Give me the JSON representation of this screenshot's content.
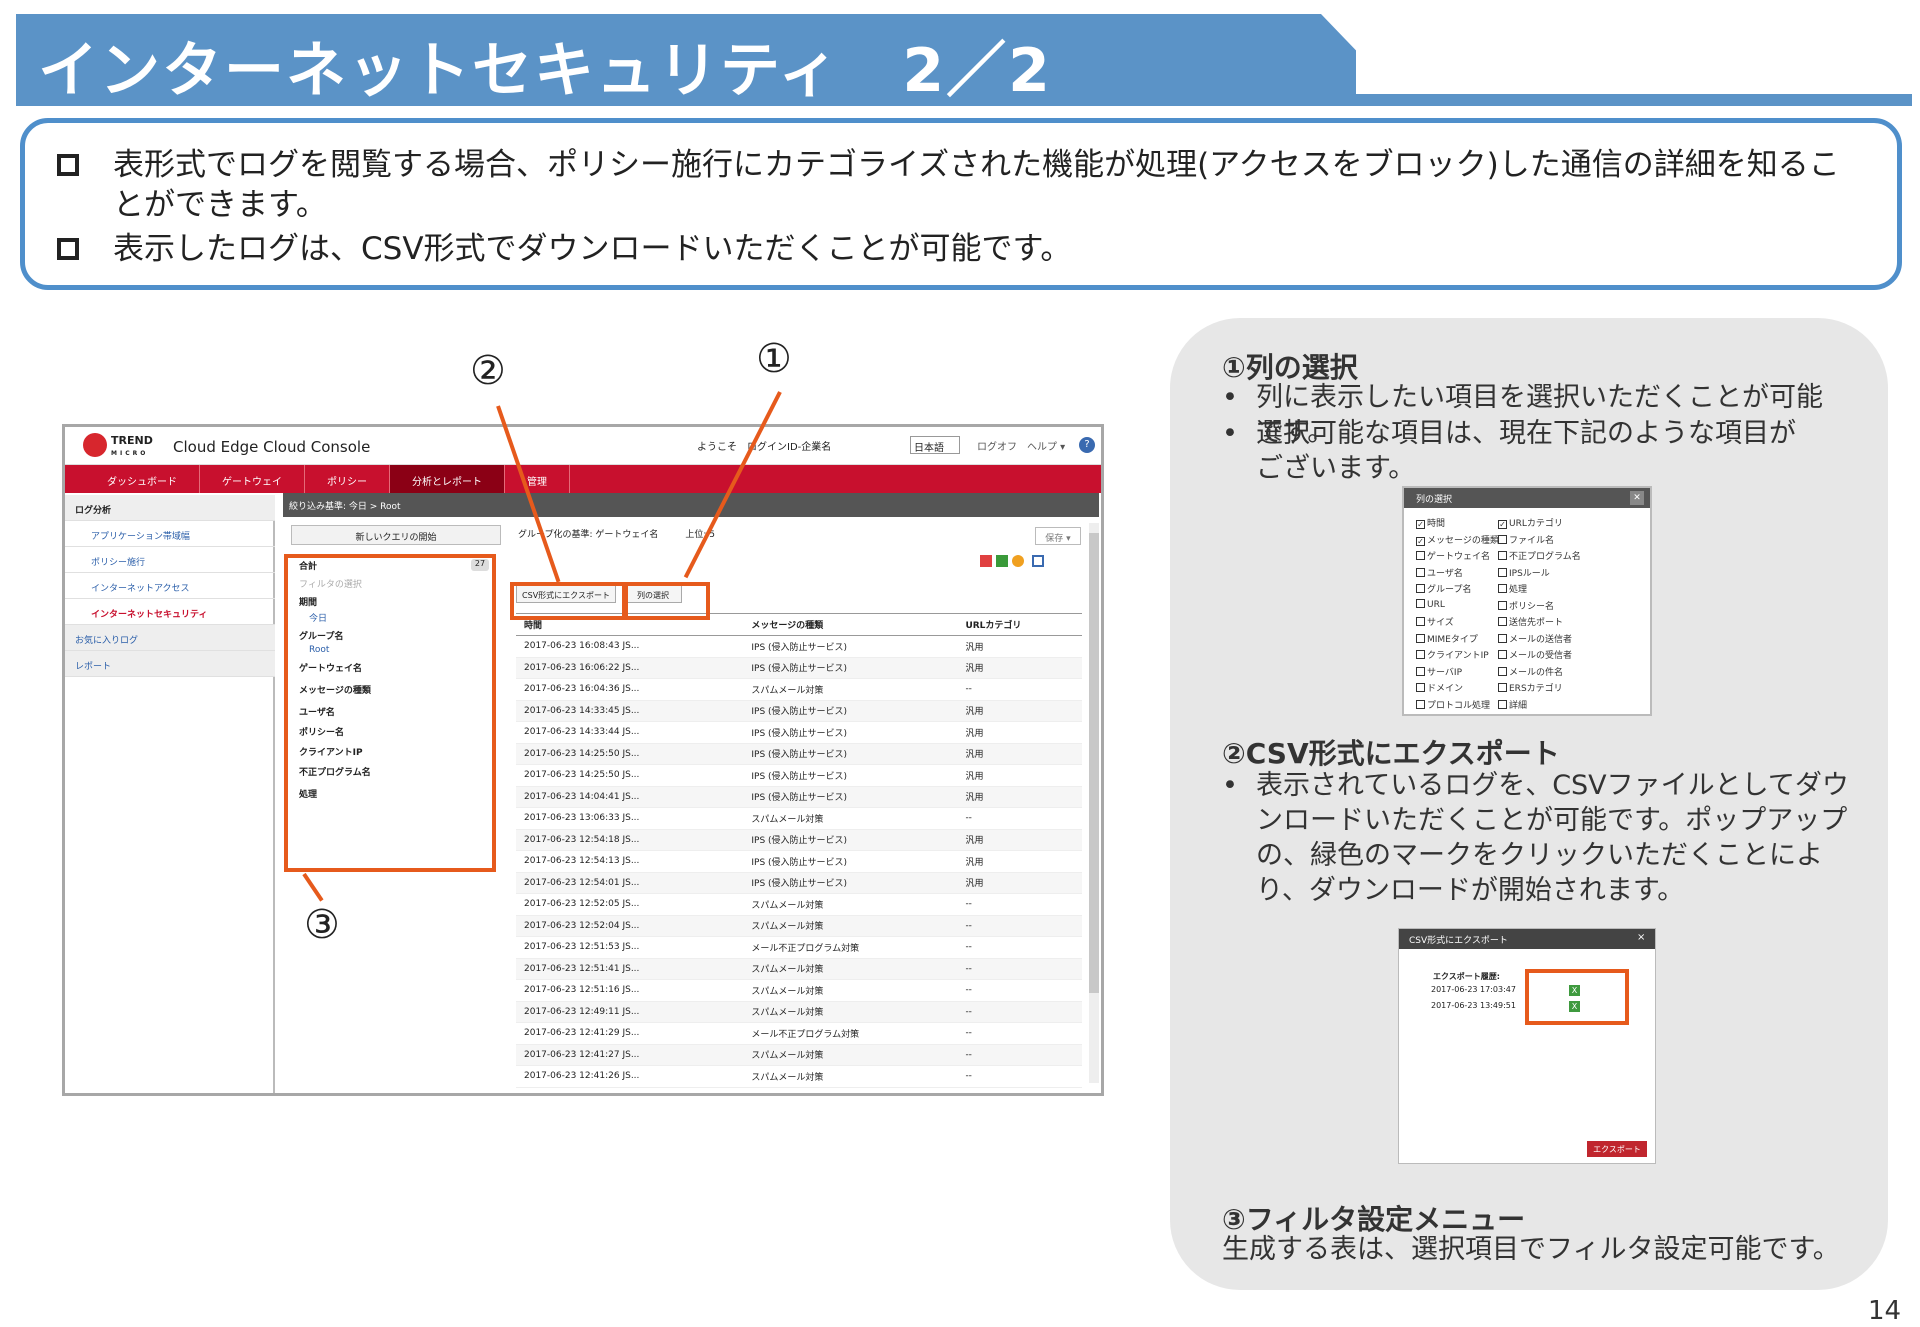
{
  "title": "インターネットセキュリティ　2／2",
  "bullets": [
    "表形式でログを閲覧する場合、ポリシー施行にカテゴライズされた機能が処理(アクセスをブロック)した通信の詳細を知ることができます。",
    "表示したログは、CSV形式でダウンロードいただくことが可能です。"
  ],
  "console": {
    "logo_text_1": "TREND",
    "logo_text_2": "MICRO",
    "app_title": "Cloud Edge Cloud Console",
    "welcome": "ようこそ　ログインID-企業名",
    "language": "日本語",
    "logout": "ログオフ",
    "help": "ヘルプ ▾",
    "help_icon": "?",
    "nav_tabs": [
      "ダッシュボード",
      "ゲートウェイ",
      "ポリシー",
      "分析とレポート",
      "管理"
    ],
    "left_menu": [
      "ログ分析",
      "アプリケーション帯域幅",
      "ポリシー施行",
      "インターネットアクセス",
      "インターネットセキュリティ",
      "お気に入りログ",
      "レポート"
    ],
    "breadcrumb": "絞り込み基準:  今日 > Root",
    "new_query": "新しいクエリの開始",
    "group_by": "グループ化の基準:  ゲートウェイ名",
    "top": "上位:  5",
    "save": "保存 ▾",
    "filter_total": "合計",
    "filter_total_count": "27",
    "filter_placeholder": "フィルタの選択",
    "filter_items": [
      "期間",
      "今日",
      "グループ名",
      "Root",
      "ゲートウェイ名",
      "メッセージの種類",
      "ユーザ名",
      "ポリシー名",
      "クライアントIP",
      "不正プログラム名",
      "処理"
    ],
    "btn_csv": "CSV形式にエクスポート",
    "btn_cols": "列の選択",
    "table_headers": [
      "時間",
      "メッセージの種類",
      "URLカテゴリ"
    ],
    "table_rows": [
      [
        "2017-06-23 16:08:43 JS...",
        "IPS (侵入防止サービス)",
        "汎用"
      ],
      [
        "2017-06-23 16:06:22 JS...",
        "IPS (侵入防止サービス)",
        "汎用"
      ],
      [
        "2017-06-23 16:04:36 JS...",
        "スパムメール対策",
        "--"
      ],
      [
        "2017-06-23 14:33:45 JS...",
        "IPS (侵入防止サービス)",
        "汎用"
      ],
      [
        "2017-06-23 14:33:44 JS...",
        "IPS (侵入防止サービス)",
        "汎用"
      ],
      [
        "2017-06-23 14:25:50 JS...",
        "IPS (侵入防止サービス)",
        "汎用"
      ],
      [
        "2017-06-23 14:25:50 JS...",
        "IPS (侵入防止サービス)",
        "汎用"
      ],
      [
        "2017-06-23 14:04:41 JS...",
        "IPS (侵入防止サービス)",
        "汎用"
      ],
      [
        "2017-06-23 13:06:33 JS...",
        "スパムメール対策",
        "--"
      ],
      [
        "2017-06-23 12:54:18 JS...",
        "IPS (侵入防止サービス)",
        "汎用"
      ],
      [
        "2017-06-23 12:54:13 JS...",
        "IPS (侵入防止サービス)",
        "汎用"
      ],
      [
        "2017-06-23 12:54:01 JS...",
        "IPS (侵入防止サービス)",
        "汎用"
      ],
      [
        "2017-06-23 12:52:05 JS...",
        "スパムメール対策",
        "--"
      ],
      [
        "2017-06-23 12:52:04 JS...",
        "スパムメール対策",
        "--"
      ],
      [
        "2017-06-23 12:51:53 JS...",
        "メール不正プログラム対策",
        "--"
      ],
      [
        "2017-06-23 12:51:41 JS...",
        "スパムメール対策",
        "--"
      ],
      [
        "2017-06-23 12:51:16 JS...",
        "スパムメール対策",
        "--"
      ],
      [
        "2017-06-23 12:49:11 JS...",
        "スパムメール対策",
        "--"
      ],
      [
        "2017-06-23 12:41:29 JS...",
        "メール不正プログラム対策",
        "--"
      ],
      [
        "2017-06-23 12:41:27 JS...",
        "スパムメール対策",
        "--"
      ],
      [
        "2017-06-23 12:41:26 JS...",
        "スパムメール対策",
        "--"
      ]
    ]
  },
  "callouts": {
    "c1": "①",
    "c2": "②",
    "c3": "③"
  },
  "right": {
    "h1": "①列の選択",
    "h1_b1": "列に表示したい項目を選択いただくことが可能です。",
    "h1_b2": "選択可能な項目は、現在下記のような項目がございます。",
    "col_dialog_title": "列の選択",
    "col_dialog_close": "✕",
    "col_left": [
      {
        "label": "時間",
        "checked": true
      },
      {
        "label": "メッセージの種類",
        "checked": true
      },
      {
        "label": "ゲートウェイ名",
        "checked": false
      },
      {
        "label": "ユーザ名",
        "checked": false
      },
      {
        "label": "グループ名",
        "checked": false
      },
      {
        "label": "URL",
        "checked": false
      },
      {
        "label": "サイズ",
        "checked": false
      },
      {
        "label": "MIMEタイプ",
        "checked": false
      },
      {
        "label": "クライアントIP",
        "checked": false
      },
      {
        "label": "サーバIP",
        "checked": false
      },
      {
        "label": "ドメイン",
        "checked": false
      },
      {
        "label": "プロトコル処理",
        "checked": false
      }
    ],
    "col_right": [
      {
        "label": "URLカテゴリ",
        "checked": true
      },
      {
        "label": "ファイル名",
        "checked": false
      },
      {
        "label": "不正プログラム名",
        "checked": false
      },
      {
        "label": "IPSルール",
        "checked": false
      },
      {
        "label": "処理",
        "checked": false
      },
      {
        "label": "ポリシー名",
        "checked": false
      },
      {
        "label": "送信先ポート",
        "checked": false
      },
      {
        "label": "メールの送信者",
        "checked": false
      },
      {
        "label": "メールの受信者",
        "checked": false
      },
      {
        "label": "メールの件名",
        "checked": false
      },
      {
        "label": "ERSカテゴリ",
        "checked": false
      },
      {
        "label": "詳細",
        "checked": false
      }
    ],
    "h2": "②CSV形式にエクスポート",
    "h2_b1": "表示されているログを、CSVファイルとしてダウンロードいただくことが可能です。ポップアップの、緑色のマークをクリックいただくことにより、ダウンロードが開始されます。",
    "exp_title": "CSV形式にエクスポート",
    "exp_close": "×",
    "exp_label": "エクスポート履歴:",
    "exp_rows": [
      "2017-06-23 17:03:47",
      "2017-06-23 13:49:51"
    ],
    "exp_icon": "X",
    "exp_button": "エクスポート",
    "h3": "③フィルタ設定メニュー",
    "h3_t": "生成する表は、選択項目でフィルタ設定可能です。"
  },
  "page_number": "14",
  "colors": {
    "banner": "#5b93c7",
    "accent": "#e65a1c",
    "nav": "#c8102e"
  }
}
